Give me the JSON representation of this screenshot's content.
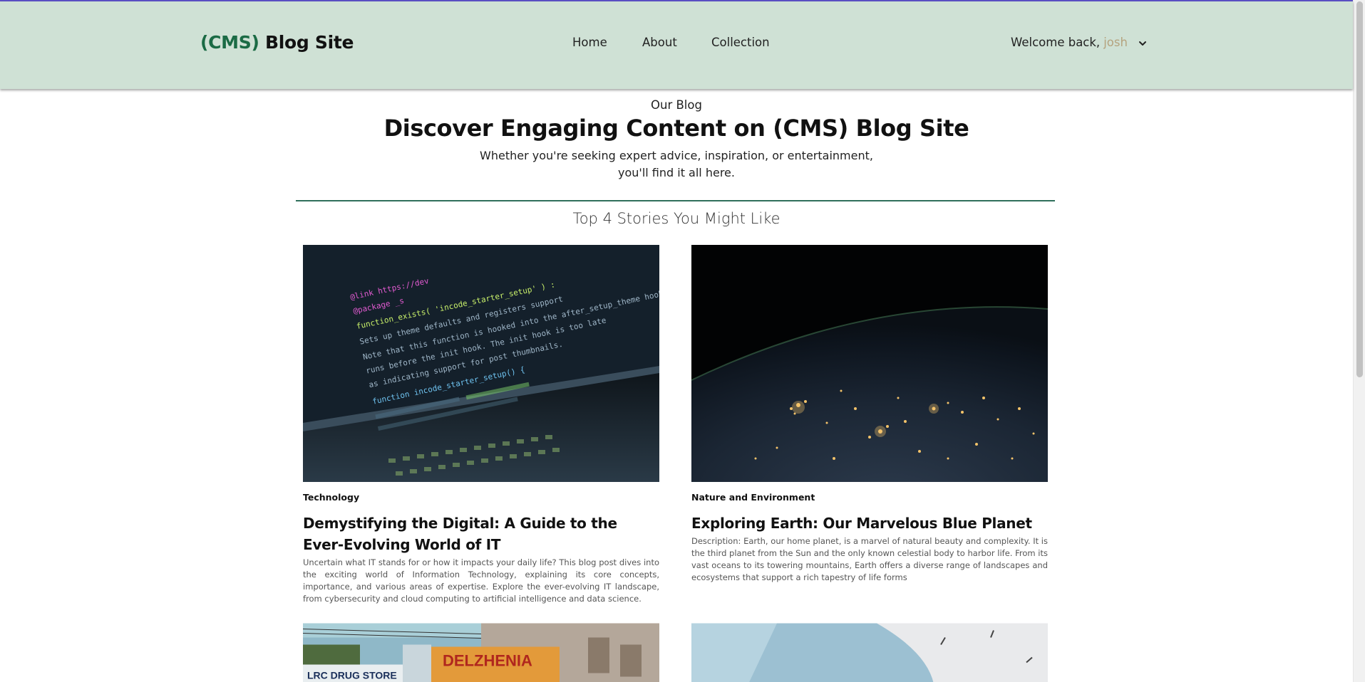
{
  "header": {
    "logo_accent": "(CMS)",
    "logo_text": " Blog Site",
    "nav": [
      {
        "label": "Home"
      },
      {
        "label": "About"
      },
      {
        "label": "Collection"
      }
    ],
    "welcome_text": "Welcome back,",
    "username": "josh",
    "icons": {
      "dropdown": "chevron-down-icon"
    }
  },
  "hero": {
    "eyebrow": "Our Blog",
    "headline": "Discover Engaging Content on (CMS) Blog Site",
    "subtitle_line1": "Whether you're seeking expert advice, inspiration, or entertainment,",
    "subtitle_line2": "you'll find it all here."
  },
  "section": {
    "title": "Top 4 Stories You Might Like"
  },
  "cards": [
    {
      "category": "Technology",
      "title": "Demystifying the Digital: A Guide to the Ever-Evolving World of IT",
      "description": "Uncertain what IT stands for or how it impacts your daily life? This blog post dives into the exciting world of Information Technology, explaining its core concepts, importance, and various areas of expertise. Explore the ever-evolving IT landscape, from cybersecurity and cloud computing to artificial intelligence and data science.",
      "image_code_lines": [
        "@link https://dev",
        "@package _s",
        "function_exists( 'incode_starter_setup' ) :",
        "Sets up theme defaults and registers support",
        "Note that this function is hooked into the after_setup_theme hook",
        "runs before the init hook. The init hook is too late",
        "as indicating support for post thumbnails.",
        "function incode_starter_setup() {"
      ]
    },
    {
      "category": "Nature and Environment",
      "title": "Exploring Earth: Our Marvelous Blue Planet",
      "description": "Description: Earth, our home planet, is a marvel of natural beauty and complexity. It is the third planet from the Sun and the only known celestial body to harbor life. From its vast oceans to its towering mountains, Earth offers a diverse range of landscapes and ecosystems that support a rich tapestry of life forms"
    },
    {
      "image_signs": [
        "LRC DRUG STORE",
        "DELZHENIA"
      ]
    },
    {}
  ],
  "colors": {
    "header_bg": "#cfe1d5",
    "brand_green": "#1b6b45",
    "divider": "#2f6f5b",
    "username": "#b5a37e",
    "top_accent": "#5b4fc4"
  }
}
